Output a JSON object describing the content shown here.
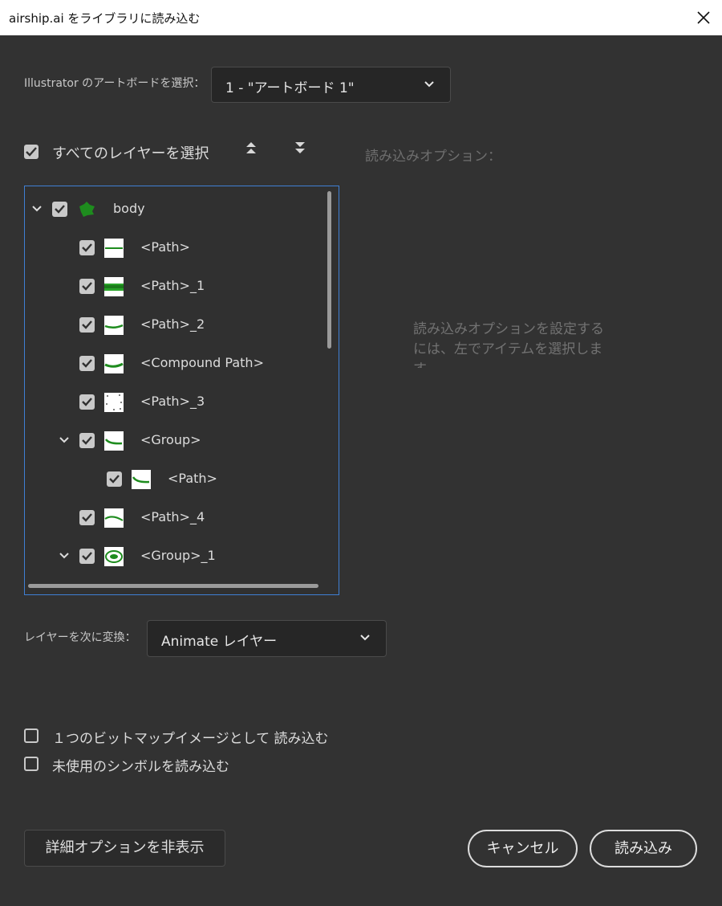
{
  "window": {
    "title": "airship.ai をライブラリに読み込む",
    "close_icon": "close-icon"
  },
  "artboard": {
    "label": "Illustrator のアートボードを選択：",
    "selected": "1 - \"アートボード 1\""
  },
  "layers": {
    "select_all_label": "すべてのレイヤーを選択",
    "select_all_checked": true,
    "expand_all_icon": "chevrons-up-icon",
    "collapse_all_icon": "chevrons-down-icon",
    "items": [
      {
        "label": "body",
        "checked": true,
        "expanded": true,
        "thumb": "blob"
      },
      {
        "label": "<Path>",
        "checked": true,
        "thumb": "line"
      },
      {
        "label": "<Path>_1",
        "checked": true,
        "thumb": "band"
      },
      {
        "label": "<Path>_2",
        "checked": true,
        "thumb": "curve"
      },
      {
        "label": "<Compound Path>",
        "checked": true,
        "thumb": "curve"
      },
      {
        "label": "<Path>_3",
        "checked": true,
        "thumb": "dots"
      },
      {
        "label": "<Group>",
        "checked": true,
        "expanded": true,
        "thumb": "smile"
      },
      {
        "label": "<Path>",
        "checked": true,
        "thumb": "smile"
      },
      {
        "label": "<Path>_4",
        "checked": true,
        "thumb": "arc"
      },
      {
        "label": "<Group>_1",
        "checked": true,
        "expanded": true,
        "thumb": "eye"
      }
    ]
  },
  "import_options": {
    "title": "読み込みオプション：",
    "hint": "読み込みオプションを設定するには、左でアイテムを選択します"
  },
  "convert": {
    "label": "レイヤーを次に変換：",
    "selected": "Animate レイヤー"
  },
  "options": {
    "bitmap_label": "１つのビットマップイメージとして 読み込む",
    "bitmap_checked": false,
    "unused_symbols_label": "未使用のシンボルを読み込む",
    "unused_symbols_checked": false
  },
  "buttons": {
    "hide_advanced": "詳細オプションを非表示",
    "cancel": "キャンセル",
    "import": "読み込み"
  },
  "colors": {
    "background": "#323232",
    "tree_border": "#3f7fd4",
    "thumb_green": "#1e8c1e"
  }
}
